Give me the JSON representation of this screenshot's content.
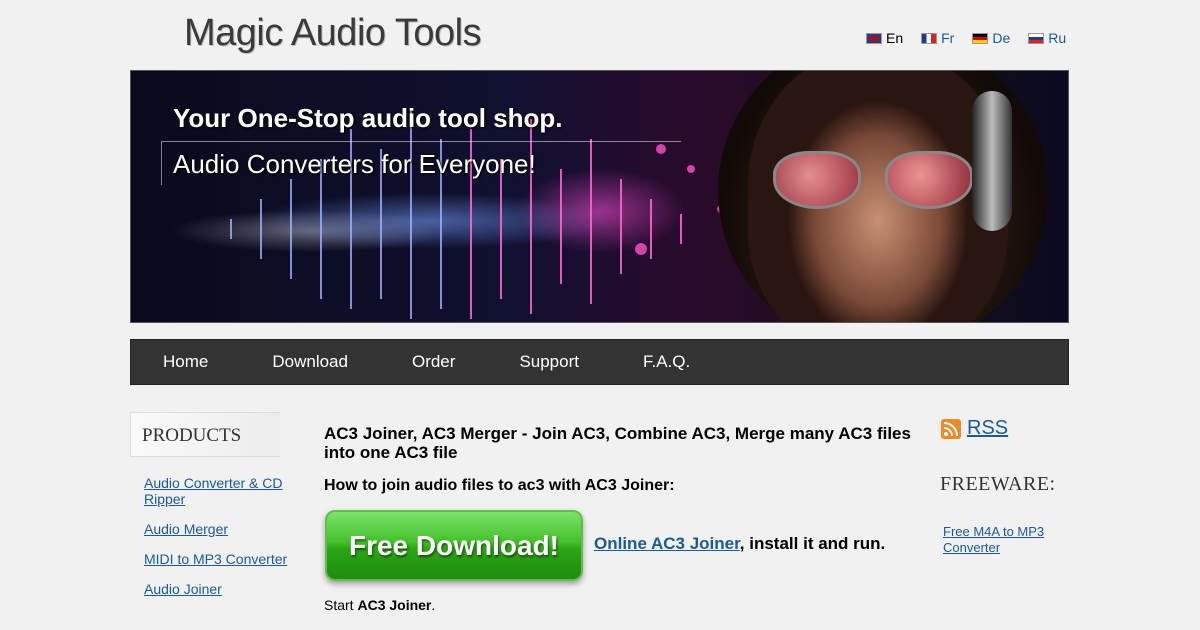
{
  "header": {
    "logo_text": "Magic Audio Tools",
    "languages": [
      {
        "code": "En",
        "flag": "uk-flag-icon"
      },
      {
        "code": "Fr",
        "flag": "france-flag-icon"
      },
      {
        "code": "De",
        "flag": "germany-flag-icon"
      },
      {
        "code": "Ru",
        "flag": "russia-flag-icon"
      }
    ]
  },
  "banner": {
    "line1": "Your One-Stop audio tool shop.",
    "line2": "Audio Converters for Everyone!"
  },
  "nav": {
    "items": [
      "Home",
      "Download",
      "Order",
      "Support",
      "F.A.Q."
    ]
  },
  "sidebar": {
    "title": "PRODUCTS",
    "items": [
      "Audio Converter & CD Ripper",
      "Audio Merger",
      "MIDI to MP3 Converter",
      "Audio Joiner"
    ]
  },
  "main": {
    "title": "AC3 Joiner, AC3 Merger - Join AC3, Combine AC3, Merge many AC3 files into one AC3 file",
    "subtitle": "How to join audio files to ac3 with AC3 Joiner:",
    "download_button": "Free Download!",
    "download_link": "Online AC3 Joiner",
    "download_suffix": ", install it and run.",
    "start_prefix": "Start ",
    "start_bold": "AC3 Joiner",
    "start_suffix": "."
  },
  "right": {
    "rss_label": "RSS",
    "rss_icon": "rss-icon",
    "freeware_title": "FREEWARE:",
    "freeware_link": "Free M4A to MP3 Converter"
  },
  "colors": {
    "link": "#1a5a9c",
    "nav_bg": "#333333",
    "page_bg": "#f1f1f1",
    "button_green": "#2ca515",
    "rss_orange": "#f08a24"
  }
}
